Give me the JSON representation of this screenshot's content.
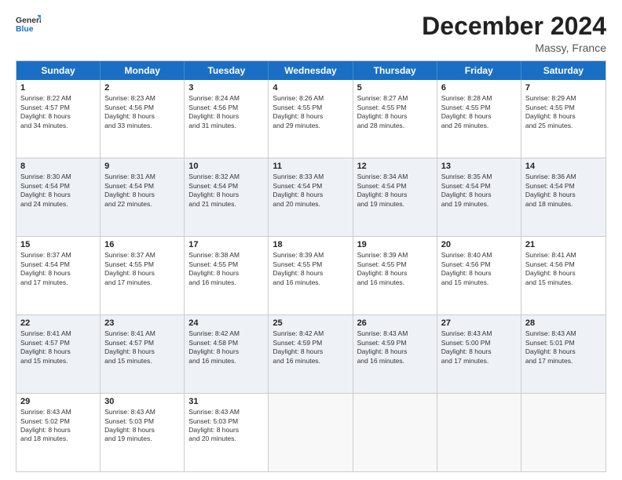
{
  "logo": {
    "text_general": "General",
    "text_blue": "Blue"
  },
  "title": "December 2024",
  "location": "Massy, France",
  "days_header": [
    "Sunday",
    "Monday",
    "Tuesday",
    "Wednesday",
    "Thursday",
    "Friday",
    "Saturday"
  ],
  "weeks": [
    {
      "alt": false,
      "cells": [
        {
          "day": "1",
          "sunrise": "Sunrise: 8:22 AM",
          "sunset": "Sunset: 4:57 PM",
          "daylight": "Daylight: 8 hours",
          "minutes": "and 34 minutes."
        },
        {
          "day": "2",
          "sunrise": "Sunrise: 8:23 AM",
          "sunset": "Sunset: 4:56 PM",
          "daylight": "Daylight: 8 hours",
          "minutes": "and 33 minutes."
        },
        {
          "day": "3",
          "sunrise": "Sunrise: 8:24 AM",
          "sunset": "Sunset: 4:56 PM",
          "daylight": "Daylight: 8 hours",
          "minutes": "and 31 minutes."
        },
        {
          "day": "4",
          "sunrise": "Sunrise: 8:26 AM",
          "sunset": "Sunset: 4:55 PM",
          "daylight": "Daylight: 8 hours",
          "minutes": "and 29 minutes."
        },
        {
          "day": "5",
          "sunrise": "Sunrise: 8:27 AM",
          "sunset": "Sunset: 4:55 PM",
          "daylight": "Daylight: 8 hours",
          "minutes": "and 28 minutes."
        },
        {
          "day": "6",
          "sunrise": "Sunrise: 8:28 AM",
          "sunset": "Sunset: 4:55 PM",
          "daylight": "Daylight: 8 hours",
          "minutes": "and 26 minutes."
        },
        {
          "day": "7",
          "sunrise": "Sunrise: 8:29 AM",
          "sunset": "Sunset: 4:55 PM",
          "daylight": "Daylight: 8 hours",
          "minutes": "and 25 minutes."
        }
      ]
    },
    {
      "alt": true,
      "cells": [
        {
          "day": "8",
          "sunrise": "Sunrise: 8:30 AM",
          "sunset": "Sunset: 4:54 PM",
          "daylight": "Daylight: 8 hours",
          "minutes": "and 24 minutes."
        },
        {
          "day": "9",
          "sunrise": "Sunrise: 8:31 AM",
          "sunset": "Sunset: 4:54 PM",
          "daylight": "Daylight: 8 hours",
          "minutes": "and 22 minutes."
        },
        {
          "day": "10",
          "sunrise": "Sunrise: 8:32 AM",
          "sunset": "Sunset: 4:54 PM",
          "daylight": "Daylight: 8 hours",
          "minutes": "and 21 minutes."
        },
        {
          "day": "11",
          "sunrise": "Sunrise: 8:33 AM",
          "sunset": "Sunset: 4:54 PM",
          "daylight": "Daylight: 8 hours",
          "minutes": "and 20 minutes."
        },
        {
          "day": "12",
          "sunrise": "Sunrise: 8:34 AM",
          "sunset": "Sunset: 4:54 PM",
          "daylight": "Daylight: 8 hours",
          "minutes": "and 19 minutes."
        },
        {
          "day": "13",
          "sunrise": "Sunrise: 8:35 AM",
          "sunset": "Sunset: 4:54 PM",
          "daylight": "Daylight: 8 hours",
          "minutes": "and 19 minutes."
        },
        {
          "day": "14",
          "sunrise": "Sunrise: 8:36 AM",
          "sunset": "Sunset: 4:54 PM",
          "daylight": "Daylight: 8 hours",
          "minutes": "and 18 minutes."
        }
      ]
    },
    {
      "alt": false,
      "cells": [
        {
          "day": "15",
          "sunrise": "Sunrise: 8:37 AM",
          "sunset": "Sunset: 4:54 PM",
          "daylight": "Daylight: 8 hours",
          "minutes": "and 17 minutes."
        },
        {
          "day": "16",
          "sunrise": "Sunrise: 8:37 AM",
          "sunset": "Sunset: 4:55 PM",
          "daylight": "Daylight: 8 hours",
          "minutes": "and 17 minutes."
        },
        {
          "day": "17",
          "sunrise": "Sunrise: 8:38 AM",
          "sunset": "Sunset: 4:55 PM",
          "daylight": "Daylight: 8 hours",
          "minutes": "and 16 minutes."
        },
        {
          "day": "18",
          "sunrise": "Sunrise: 8:39 AM",
          "sunset": "Sunset: 4:55 PM",
          "daylight": "Daylight: 8 hours",
          "minutes": "and 16 minutes."
        },
        {
          "day": "19",
          "sunrise": "Sunrise: 8:39 AM",
          "sunset": "Sunset: 4:55 PM",
          "daylight": "Daylight: 8 hours",
          "minutes": "and 16 minutes."
        },
        {
          "day": "20",
          "sunrise": "Sunrise: 8:40 AM",
          "sunset": "Sunset: 4:56 PM",
          "daylight": "Daylight: 8 hours",
          "minutes": "and 15 minutes."
        },
        {
          "day": "21",
          "sunrise": "Sunrise: 8:41 AM",
          "sunset": "Sunset: 4:56 PM",
          "daylight": "Daylight: 8 hours",
          "minutes": "and 15 minutes."
        }
      ]
    },
    {
      "alt": true,
      "cells": [
        {
          "day": "22",
          "sunrise": "Sunrise: 8:41 AM",
          "sunset": "Sunset: 4:57 PM",
          "daylight": "Daylight: 8 hours",
          "minutes": "and 15 minutes."
        },
        {
          "day": "23",
          "sunrise": "Sunrise: 8:41 AM",
          "sunset": "Sunset: 4:57 PM",
          "daylight": "Daylight: 8 hours",
          "minutes": "and 15 minutes."
        },
        {
          "day": "24",
          "sunrise": "Sunrise: 8:42 AM",
          "sunset": "Sunset: 4:58 PM",
          "daylight": "Daylight: 8 hours",
          "minutes": "and 16 minutes."
        },
        {
          "day": "25",
          "sunrise": "Sunrise: 8:42 AM",
          "sunset": "Sunset: 4:59 PM",
          "daylight": "Daylight: 8 hours",
          "minutes": "and 16 minutes."
        },
        {
          "day": "26",
          "sunrise": "Sunrise: 8:43 AM",
          "sunset": "Sunset: 4:59 PM",
          "daylight": "Daylight: 8 hours",
          "minutes": "and 16 minutes."
        },
        {
          "day": "27",
          "sunrise": "Sunrise: 8:43 AM",
          "sunset": "Sunset: 5:00 PM",
          "daylight": "Daylight: 8 hours",
          "minutes": "and 17 minutes."
        },
        {
          "day": "28",
          "sunrise": "Sunrise: 8:43 AM",
          "sunset": "Sunset: 5:01 PM",
          "daylight": "Daylight: 8 hours",
          "minutes": "and 17 minutes."
        }
      ]
    },
    {
      "alt": false,
      "cells": [
        {
          "day": "29",
          "sunrise": "Sunrise: 8:43 AM",
          "sunset": "Sunset: 5:02 PM",
          "daylight": "Daylight: 8 hours",
          "minutes": "and 18 minutes."
        },
        {
          "day": "30",
          "sunrise": "Sunrise: 8:43 AM",
          "sunset": "Sunset: 5:03 PM",
          "daylight": "Daylight: 8 hours",
          "minutes": "and 19 minutes."
        },
        {
          "day": "31",
          "sunrise": "Sunrise: 8:43 AM",
          "sunset": "Sunset: 5:03 PM",
          "daylight": "Daylight: 8 hours",
          "minutes": "and 20 minutes."
        },
        {
          "day": "",
          "sunrise": "",
          "sunset": "",
          "daylight": "",
          "minutes": ""
        },
        {
          "day": "",
          "sunrise": "",
          "sunset": "",
          "daylight": "",
          "minutes": ""
        },
        {
          "day": "",
          "sunrise": "",
          "sunset": "",
          "daylight": "",
          "minutes": ""
        },
        {
          "day": "",
          "sunrise": "",
          "sunset": "",
          "daylight": "",
          "minutes": ""
        }
      ]
    }
  ]
}
